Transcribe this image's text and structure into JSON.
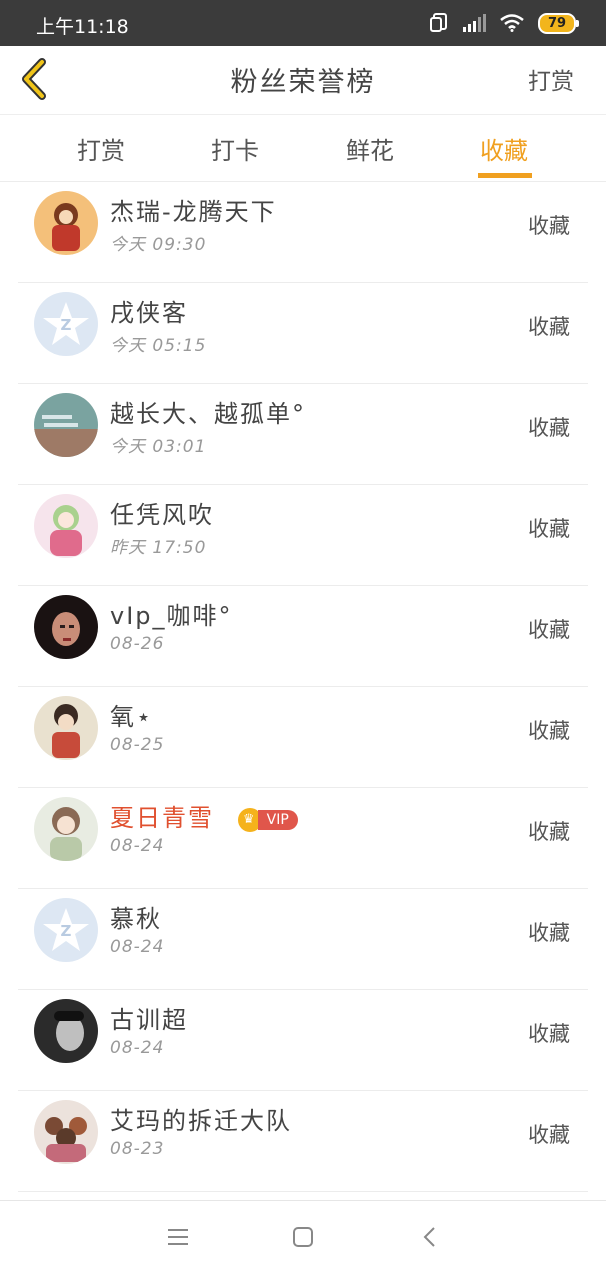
{
  "status_bar": {
    "time": "上午11:18",
    "battery": "79",
    "icons": [
      "sim-icon",
      "signal-icon",
      "wifi-icon",
      "battery-icon"
    ]
  },
  "header": {
    "title": "粉丝荣誉榜",
    "right_action": "打赏"
  },
  "tabs": [
    {
      "label": "打赏",
      "active": false
    },
    {
      "label": "打卡",
      "active": false
    },
    {
      "label": "鲜花",
      "active": false
    },
    {
      "label": "收藏",
      "active": true
    }
  ],
  "accent_color": "#f0a020",
  "rows": [
    {
      "name": "杰瑞-龙腾天下",
      "date": "今天 09:30",
      "action": "收藏",
      "vip": false
    },
    {
      "name": "戌侠客",
      "date": "今天 05:15",
      "action": "收藏",
      "vip": false
    },
    {
      "name": "越长大、越孤单°",
      "date": "今天 03:01",
      "action": "收藏",
      "vip": false
    },
    {
      "name": "任凭风吹",
      "date": "昨天 17:50",
      "action": "收藏",
      "vip": false
    },
    {
      "name": "vIp_咖啡°",
      "date": "08-26",
      "action": "收藏",
      "vip": false
    },
    {
      "name": "氧⋆",
      "date": "08-25",
      "action": "收藏",
      "vip": false
    },
    {
      "name": "夏日青雪",
      "date": "08-24",
      "action": "收藏",
      "vip": true,
      "vip_label": "VIP"
    },
    {
      "name": "慕秋",
      "date": "08-24",
      "action": "收藏",
      "vip": false
    },
    {
      "name": "古训超",
      "date": "08-24",
      "action": "收藏",
      "vip": false
    },
    {
      "name": "艾玛的拆迁大队",
      "date": "08-23",
      "action": "收藏",
      "vip": false
    }
  ],
  "nav_bar": [
    "menu-icon",
    "home-icon",
    "back-icon"
  ]
}
